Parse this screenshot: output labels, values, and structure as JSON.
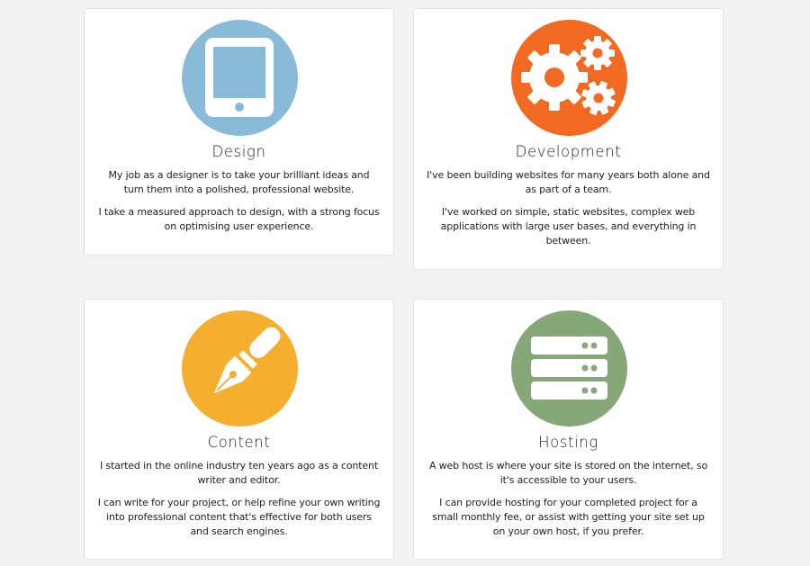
{
  "colors": {
    "page_background": "#f3f3f3",
    "card_background": "#ffffff",
    "design_circle": "#89bbd9",
    "development_circle": "#f26a21",
    "content_circle": "#f5ae2d",
    "hosting_circle": "#86a878"
  },
  "services": [
    {
      "icon": "tablet-icon",
      "title": "Design",
      "paragraphs": [
        "My job as a designer is to take your brilliant ideas and turn them into a polished, professional website.",
        "I take a measured approach to design, with a strong focus on optimising user experience."
      ]
    },
    {
      "icon": "gears-icon",
      "title": "Development",
      "paragraphs": [
        "I've been building websites for many years both alone and as part of a team.",
        "I've worked on simple, static websites, complex web applications with large user bases, and everything in between."
      ]
    },
    {
      "icon": "fountain-pen-icon",
      "title": "Content",
      "paragraphs": [
        "I started in the online industry ten years ago as a content writer and editor.",
        "I can write for your project, or help refine your own writing into professional content that's effective for both users and search engines."
      ]
    },
    {
      "icon": "server-icon",
      "title": "Hosting",
      "paragraphs": [
        "A web host is where your site is stored on the internet, so it's accessible to your users.",
        "I can provide hosting for your completed project for a small monthly fee, or assist with getting your site set up on your own host, if you prefer."
      ]
    }
  ]
}
